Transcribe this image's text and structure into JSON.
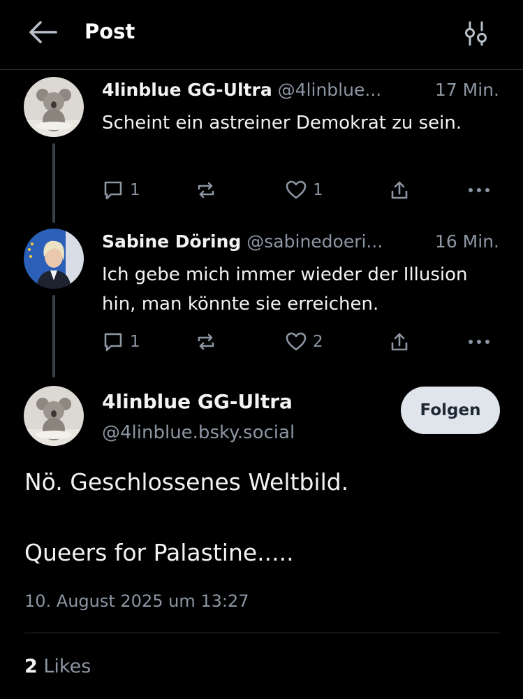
{
  "header": {
    "title": "Post",
    "back_icon": "arrow-left-icon",
    "settings_icon": "sliders-icon"
  },
  "replies": [
    {
      "name": "4linblue GG-Ultra",
      "handle": "@4linblue...",
      "time": "17 Min.",
      "text": "Scheint ein astreiner Demokrat zu sein.",
      "reply_count": "1",
      "repost_count": "",
      "like_count": "1",
      "avatar": "koala-avatar"
    },
    {
      "name": "Sabine Döring",
      "handle": "@sabinedoeri...",
      "time": "16 Min.",
      "text": "Ich gebe mich immer wieder der Illusion hin, man könnte sie erreichen.",
      "reply_count": "1",
      "repost_count": "",
      "like_count": "2",
      "avatar": "person-avatar"
    }
  ],
  "main_post": {
    "name": "4linblue GG-Ultra",
    "handle": "@4linblue.bsky.social",
    "follow_label": "Folgen",
    "text_line1": "Nö. Geschlossenes Weltbild.",
    "text_line2": "Queers for Palastine.....",
    "date": "10. August 2025 um 13:27",
    "likes_count": "2",
    "likes_label": "Likes"
  },
  "colors": {
    "background": "#000000",
    "text": "#f1f3f5",
    "muted": "#8d96a3",
    "divider": "#2b2f35",
    "follow_bg": "#dfe5eb"
  }
}
